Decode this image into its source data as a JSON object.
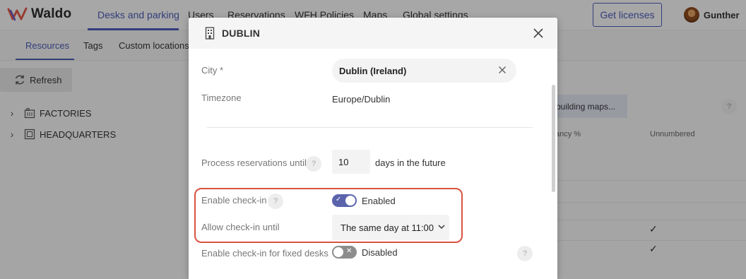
{
  "app": {
    "brand": "Waldo",
    "nav": [
      "Desks and parking",
      "Users",
      "Reservations",
      "WFH Policies",
      "Maps",
      "Global settings"
    ],
    "get_licenses": "Get licenses",
    "user_name": "Gunther"
  },
  "subnav": [
    "Resources",
    "Tags",
    "Custom locations"
  ],
  "toolbar": {
    "refresh": "Refresh"
  },
  "tree": [
    "FACTORIES",
    "HEADQUARTERS"
  ],
  "background": {
    "maps_button": "building maps...",
    "col_occupancy": "ancy %",
    "col_unnumbered": "Unnumbered",
    "help": "?"
  },
  "modal": {
    "title": "DUBLIN",
    "city_label": "City *",
    "city_value": "Dublin (Ireland)",
    "timezone_label": "Timezone",
    "timezone_value": "Europe/Dublin",
    "process_label": "Process reservations until",
    "process_value": "10",
    "process_suffix": "days in the future",
    "checkin_label": "Enable check-in",
    "checkin_state": "Enabled",
    "allow_label": "Allow check-in until",
    "allow_value": "The same day at 11:00",
    "fixed_label": "Enable check-in for fixed desks",
    "fixed_state": "Disabled",
    "help": "?"
  },
  "colors": {
    "accent": "#4c5bb4",
    "toggle_on": "#5b63ad",
    "highlight": "#d9533f"
  }
}
